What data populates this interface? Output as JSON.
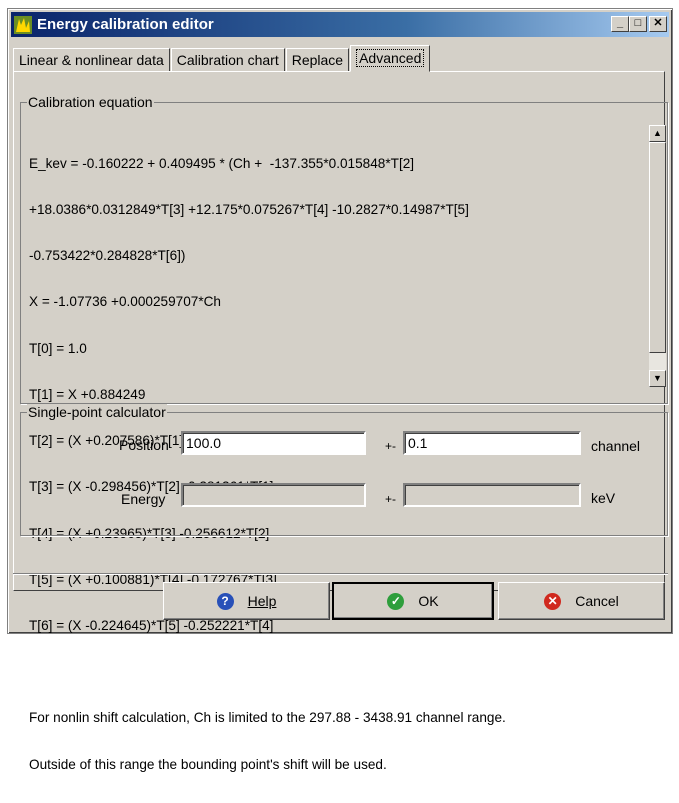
{
  "window": {
    "title": "Energy calibration editor"
  },
  "tabs": [
    {
      "label": "Linear & nonlinear data"
    },
    {
      "label": "Calibration chart"
    },
    {
      "label": "Replace"
    },
    {
      "label": "Advanced"
    }
  ],
  "equation": {
    "legend": "Calibration equation",
    "lines": [
      "E_kev = -0.160222 + 0.409495 * (Ch +  -137.355*0.015848*T[2]",
      "+18.0386*0.0312849*T[3] +12.175*0.075267*T[4] -10.2827*0.14987*T[5]",
      "-0.753422*0.284828*T[6])",
      "X = -1.07736 +0.000259707*Ch",
      "T[0] = 1.0",
      "T[1] = X +0.884249",
      "T[2] = (X +0.207586)*T[1] -0.0489527*T[0]",
      "T[3] = (X -0.298456)*T[2] -0.281261*T[1]",
      "T[4] = (X +0.23965)*T[3] -0.256612*T[2]",
      "T[5] = (X +0.100881)*T[4] -0.172767*T[3]",
      "T[6] = (X -0.224645)*T[5] -0.252221*T[4]",
      "",
      "For nonlin shift calculation, Ch is limited to the 297.88 - 3438.91 channel range.",
      "Outside of this range the bounding point's shift will be used."
    ]
  },
  "calculator": {
    "legend": "Single-point calculator",
    "position_label": "Position",
    "position_value": "100.0",
    "pm": "+-",
    "position_err": "0.1",
    "position_unit": "channel",
    "energy_label": "Energy",
    "energy_value": "",
    "energy_err": "",
    "energy_unit": "keV"
  },
  "buttons": {
    "help": "Help",
    "ok": "OK",
    "cancel": "Cancel"
  },
  "colors": {
    "title_start": "#0a246a",
    "title_end": "#a6caf0",
    "face": "#d4d0c8"
  }
}
